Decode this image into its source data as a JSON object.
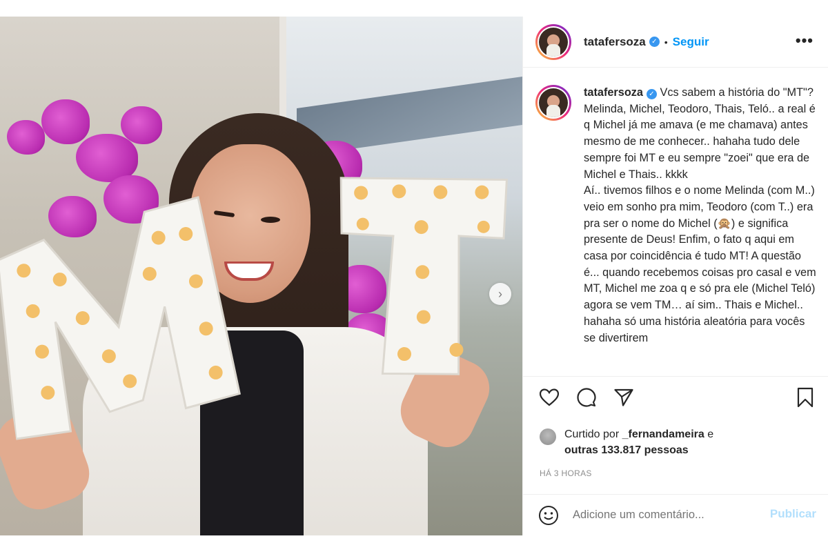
{
  "post": {
    "username": "tatafersoza",
    "separator": "•",
    "follow_label": "Seguir",
    "more_label": "•••",
    "caption_text": " Vcs sabem a história do \"MT\"? Melinda, Michel, Teodoro, Thais, Teló.. a real é q Michel já me amava (e me chamava) antes mesmo de me conhecer.. hahaha tudo dele sempre foi MT e eu sempre \"zoei\" que era de Michel e Thais.. kkkk\nAí.. tivemos filhos e o nome Melinda (com M..) veio em sonho pra mim, Teodoro (com T..) era pra ser o nome do Michel (🙊) e significa presente de Deus! Enfim, o fato q aqui em casa por coincidência é tudo MT! A questão é... quando recebemos coisas pro casal e vem MT, Michel me zoa q e só pra ele (Michel Teló) agora se vem TM… aí sim.. Thais e Michel.. hahaha só uma história aleatória para vocês se divertirem",
    "likes_prefix": "Curtido por ",
    "likes_user": "_fernandameira",
    "likes_mid": " e",
    "likes_others": "outras 133.817 pessoas",
    "timestamp": "HÁ 3 HORAS",
    "comment_placeholder": "Adicione um comentário...",
    "publish_label": "Publicar",
    "carousel_next": "›"
  },
  "icons": {
    "verified": "verified-badge-icon",
    "like": "heart-icon",
    "comment": "comment-icon",
    "share": "send-icon",
    "save": "bookmark-icon",
    "emoji": "emoji-icon"
  },
  "colors": {
    "link_blue": "#0095f6",
    "publish_disabled": "#b2dffc",
    "muted": "#8e8e8e",
    "text": "#262626"
  }
}
